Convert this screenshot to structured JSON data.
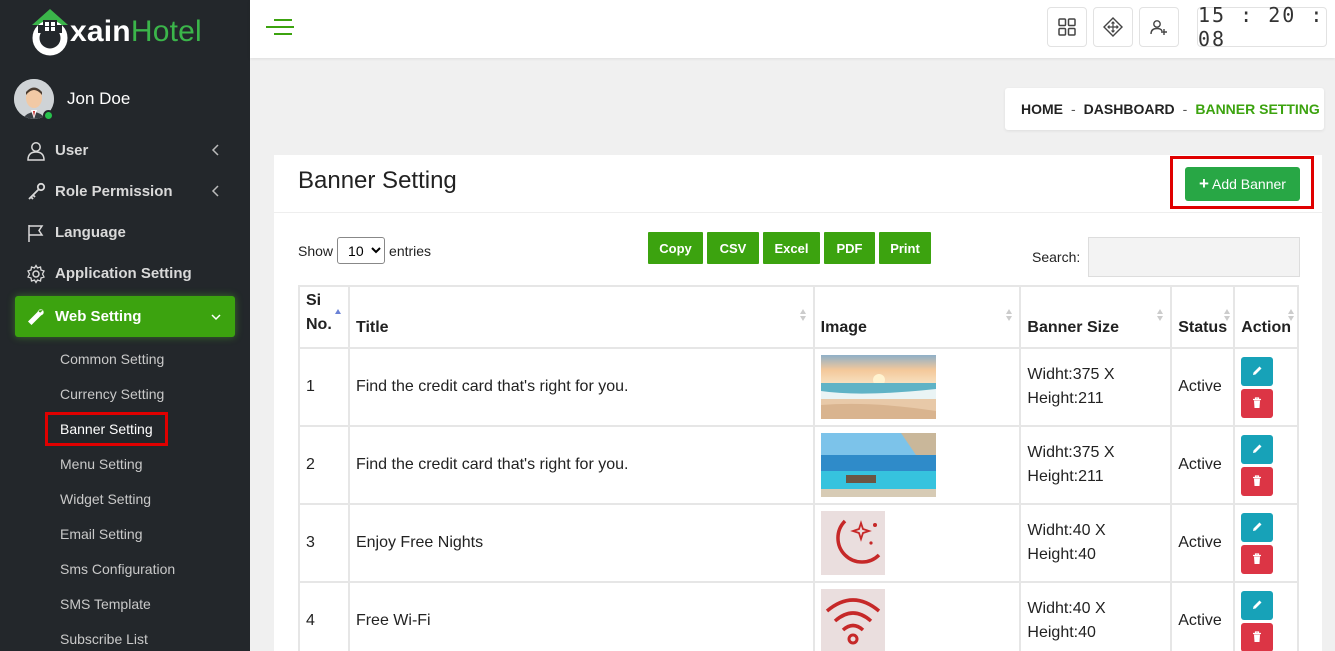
{
  "brand": {
    "logo_letter": "U",
    "name_white": "xain",
    "name_green": "Hotel"
  },
  "user": {
    "name": "Jon Doe",
    "status": "online"
  },
  "menu": {
    "items": [
      {
        "label": "User",
        "icon": "user-icon",
        "has_submenu": true
      },
      {
        "label": "Role Permission",
        "icon": "key-icon",
        "has_submenu": true
      },
      {
        "label": "Language",
        "icon": "flag-icon",
        "has_submenu": false
      },
      {
        "label": "Application Setting",
        "icon": "gear-icon",
        "has_submenu": false
      },
      {
        "label": "Web Setting",
        "icon": "wrench-icon",
        "has_submenu": true,
        "expanded": true
      }
    ],
    "submenu": [
      "Common Setting",
      "Currency Setting",
      "Banner Setting",
      "Menu Setting",
      "Widget Setting",
      "Email Setting",
      "Sms Configuration",
      "SMS Template",
      "Subscribe List"
    ],
    "current_sub": "Banner Setting"
  },
  "topbar": {
    "clock": "15:20:08",
    "buttons": [
      "grid-icon",
      "move-icon",
      "add-user-icon"
    ]
  },
  "breadcrumb": {
    "home": "HOME",
    "dashboard": "DASHBOARD",
    "current": "BANNER SETTING",
    "sep": "-"
  },
  "page": {
    "title": "Banner Setting",
    "add_button": "Add Banner",
    "show_label": "Show",
    "entries_label": "entries",
    "page_size": "10",
    "search_label": "Search:",
    "search_value": "",
    "export_buttons": [
      "Copy",
      "CSV",
      "Excel",
      "PDF",
      "Print"
    ]
  },
  "table": {
    "columns": {
      "si": "Si No.",
      "title": "Title",
      "image": "Image",
      "size": "Banner Size",
      "status": "Status",
      "action": "Action"
    },
    "rows": [
      {
        "si": "1",
        "title": "Find the credit card that's right for you.",
        "image": "beach-sunset-image",
        "width": "Widht:375 X",
        "height": "Height:211",
        "status": "Active"
      },
      {
        "si": "2",
        "title": "Find the credit card that's right for you.",
        "image": "pool-sea-image",
        "width": "Widht:375 X",
        "height": "Height:211",
        "status": "Active"
      },
      {
        "si": "3",
        "title": "Enjoy Free Nights",
        "image": "moon-stars-icon",
        "width": "Widht:40 X",
        "height": "Height:40",
        "status": "Active"
      },
      {
        "si": "4",
        "title": "Free Wi-Fi",
        "image": "wifi-icon",
        "width": "Widht:40 X",
        "height": "Height:40",
        "status": "Active"
      }
    ]
  },
  "colors": {
    "sidebar": "#23272b",
    "accent_green": "#3ca30f",
    "button_green": "#28a745",
    "edit": "#17a2b8",
    "delete": "#dc3545",
    "highlight": "#e00000"
  }
}
